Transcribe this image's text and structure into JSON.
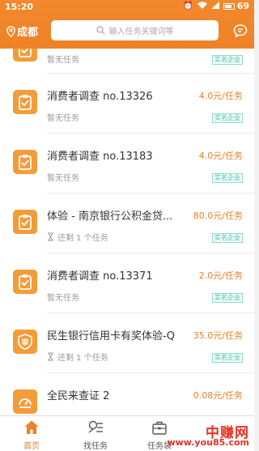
{
  "status_bar": {
    "time": "15:20",
    "battery": "69"
  },
  "header": {
    "city": "成都",
    "search_placeholder": "输入任务关键词等"
  },
  "colors": {
    "accent": "#ef8126",
    "badge": "#3cbfa8",
    "price": "#e8822a"
  },
  "tasks": [
    {
      "title": "",
      "price": "",
      "status": "暂无任务",
      "badge": "实名企业",
      "icon": "clipboard-icon"
    },
    {
      "title": "消费者调查 no.13326",
      "price": "4.0元/任务",
      "status": "暂无任务",
      "badge": "实名企业",
      "icon": "clipboard-icon"
    },
    {
      "title": "消费者调查 no.13183",
      "price": "4.0元/任务",
      "status": "暂无任务",
      "badge": "实名企业",
      "icon": "clipboard-icon"
    },
    {
      "title": "体验 - 南京银行公积金贷...",
      "price": "80.0元/任务",
      "status": "还剩 1 个任务",
      "badge": "实名企业",
      "icon": "clipboard-icon"
    },
    {
      "title": "消费者调查 no.13371",
      "price": "2.0元/任务",
      "status": "暂无任务",
      "badge": "实名企业",
      "icon": "clipboard-icon"
    },
    {
      "title": "民生银行信用卡有奖体验-Q",
      "price": "35.0元/任务",
      "status": "还剩 1 个任务",
      "badge": "实名企业",
      "icon": "review-badge-icon",
      "icon_text": "审"
    },
    {
      "title": "全民来查证 2",
      "price": "0.08元/任务",
      "status": "",
      "badge": "",
      "icon": "speedometer-icon"
    }
  ],
  "tabs": [
    {
      "label": "首页",
      "icon": "home-icon",
      "active": true
    },
    {
      "label": "找任务",
      "icon": "find-task-icon",
      "active": false
    },
    {
      "label": "任务袋",
      "icon": "task-bag-icon",
      "active": false
    }
  ],
  "watermark": {
    "line1": "中赚网",
    "line2": "www.you85.com"
  }
}
